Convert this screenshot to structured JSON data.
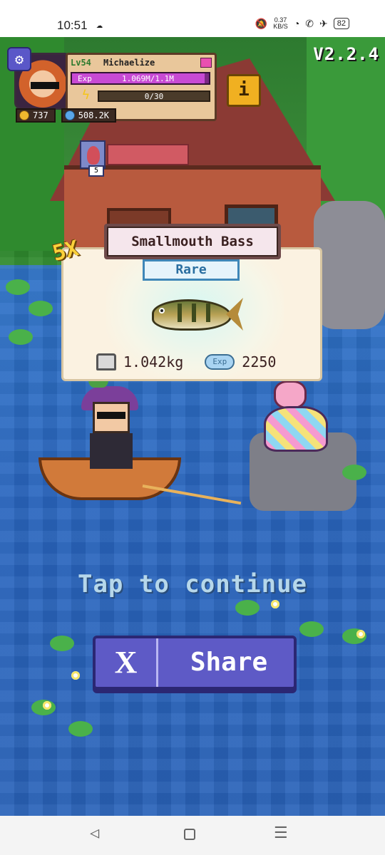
{
  "status_bar": {
    "time": "10:51",
    "network_speed": "0.37",
    "network_unit": "KB/S",
    "battery": "82"
  },
  "hud": {
    "version": "V2.2.4",
    "level": "Lv54",
    "username": "Michaelize",
    "exp_label": "Exp",
    "exp_value": "1.069M/1.1M",
    "exp_fraction": 0.97,
    "energy_value": "0/30",
    "coins": "737",
    "gems": "508.2K",
    "info_label": "i",
    "item_count": "5"
  },
  "catch": {
    "multiplier": "5X",
    "fish_name": "Smallmouth Bass",
    "rarity": "Rare",
    "weight": "1.042kg",
    "exp_label": "Exp",
    "exp_gain": "2250"
  },
  "prompt": {
    "tap_to_continue": "Tap to continue"
  },
  "share": {
    "icon_label": "X",
    "label": "Share"
  },
  "colors": {
    "water": "#2a66bf",
    "share_button": "#5e5ac6",
    "rarity_text": "#2a6ea0",
    "exp_bar": "#c84ad4"
  }
}
